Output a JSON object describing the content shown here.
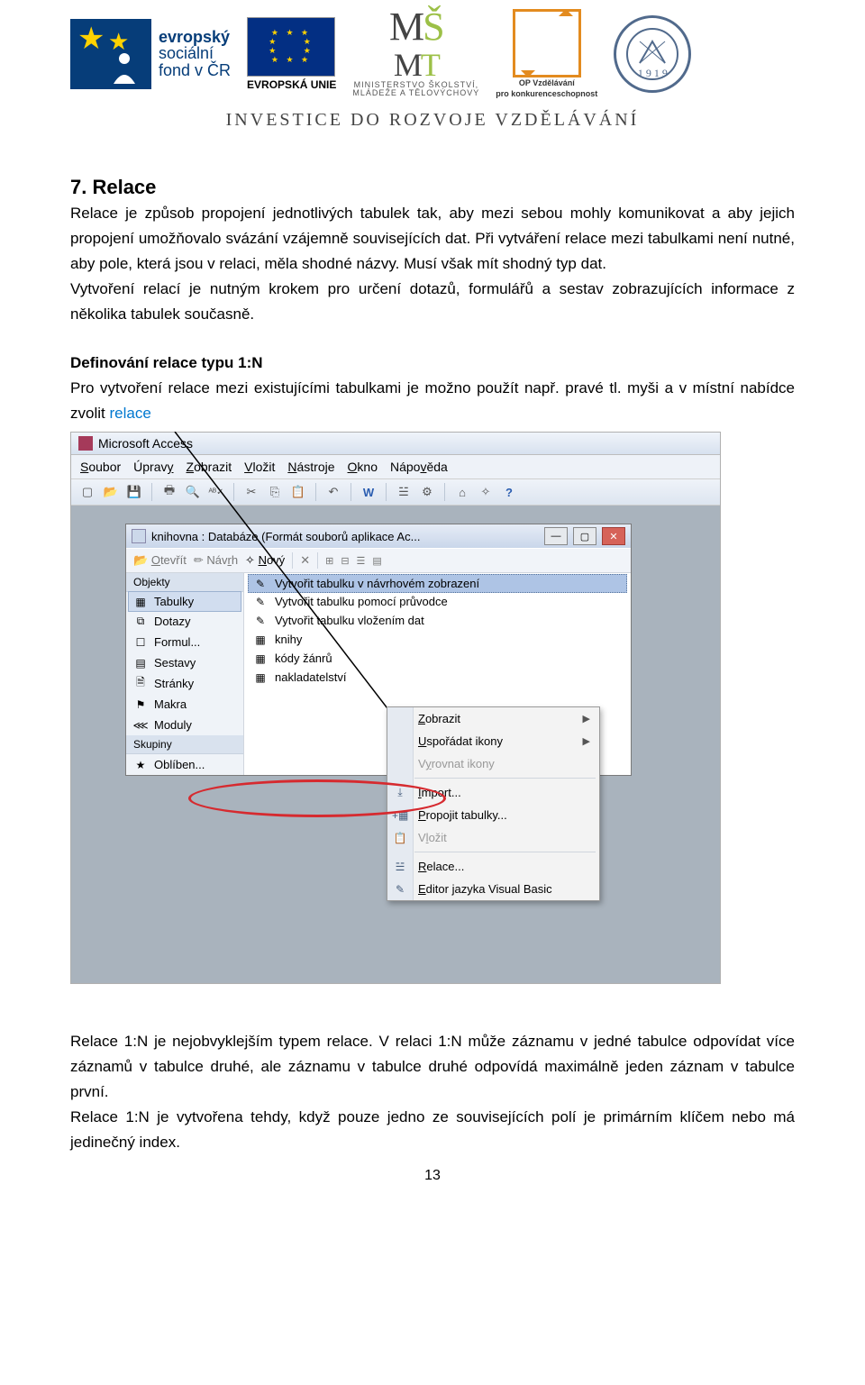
{
  "banner": {
    "esf": {
      "line1": "evropský",
      "line2": "sociální",
      "line3": "fond v ČR"
    },
    "eu_label": "EVROPSKÁ UNIE",
    "msmt": {
      "line1": "MINISTERSTVO ŠKOLSTVÍ,",
      "line2": "MLÁDEŽE A TĚLOVÝCHOVY"
    },
    "op": {
      "line1": "OP Vzdělávání",
      "line2": "pro konkurenceschopnost"
    },
    "gear_year": "1 9 1 9",
    "invest": "INVESTICE DO ROZVOJE VZDĚLÁVÁNÍ"
  },
  "text": {
    "heading": "7. Relace",
    "p1": "Relace je způsob propojení jednotlivých tabulek tak, aby mezi sebou mohly komunikovat a aby jejich propojení umožňovalo svázání vzájemně souvisejících dat. Při vytváření relace mezi tabulkami není nutné, aby pole, která jsou v relaci, měla shodné názvy. Musí však mít shodný typ dat.",
    "p2": "Vytvoření relací je nutným krokem pro určení dotazů, formulářů a sestav zobrazujících informace z několika tabulek současně.",
    "def_title": "Definování relace typu 1:N",
    "p3a": "Pro vytvoření relace mezi existujícími tabulkami je možno použít např. pravé tl. myši a v místní nabídce zvolit ",
    "p3b": "relace",
    "p_after1": "Relace 1:N je nejobvyklejším typem relace. V relaci 1:N může záznamu v jedné tabulce odpovídat více záznamů v tabulce druhé, ale záznamu v tabulce druhé odpovídá maximálně jeden záznam v tabulce první.",
    "p_after2": "Relace 1:N je vytvořena tehdy, když pouze jedno ze souvisejících polí je primárním klíčem nebo má jedinečný index.",
    "page_number": "13"
  },
  "access": {
    "app_title": "Microsoft Access",
    "menu": [
      "Soubor",
      "Úpravy",
      "Zobrazit",
      "Vložit",
      "Nástroje",
      "Okno",
      "Nápověda"
    ],
    "dbwin_title": "knihovna : Databáze (Formát souborů aplikace Ac...",
    "db_toolbar": {
      "open": "Otevřít",
      "design": "Návrh",
      "new": "Nový"
    },
    "side_groups": {
      "objects": "Objekty",
      "groups": "Skupiny"
    },
    "side_items": [
      "Tabulky",
      "Dotazy",
      "Formul...",
      "Sestavy",
      "Stránky",
      "Makra",
      "Moduly"
    ],
    "side_fav": "Oblíben...",
    "main_items": [
      "Vytvořit tabulku v návrhovém zobrazení",
      "Vytvořit tabulku pomocí průvodce",
      "Vytvořit tabulku vložením dat",
      "knihy",
      "kódy žánrů",
      "nakladatelství"
    ],
    "context": {
      "zobrazit": "Zobrazit",
      "usporadat": "Uspořádat ikony",
      "vyrovnat": "Vyrovnat ikony",
      "import": "Import...",
      "propojit": "Propojit tabulky...",
      "vlozit": "Vložit",
      "relace": "Relace...",
      "editor": "Editor jazyka Visual Basic"
    }
  }
}
